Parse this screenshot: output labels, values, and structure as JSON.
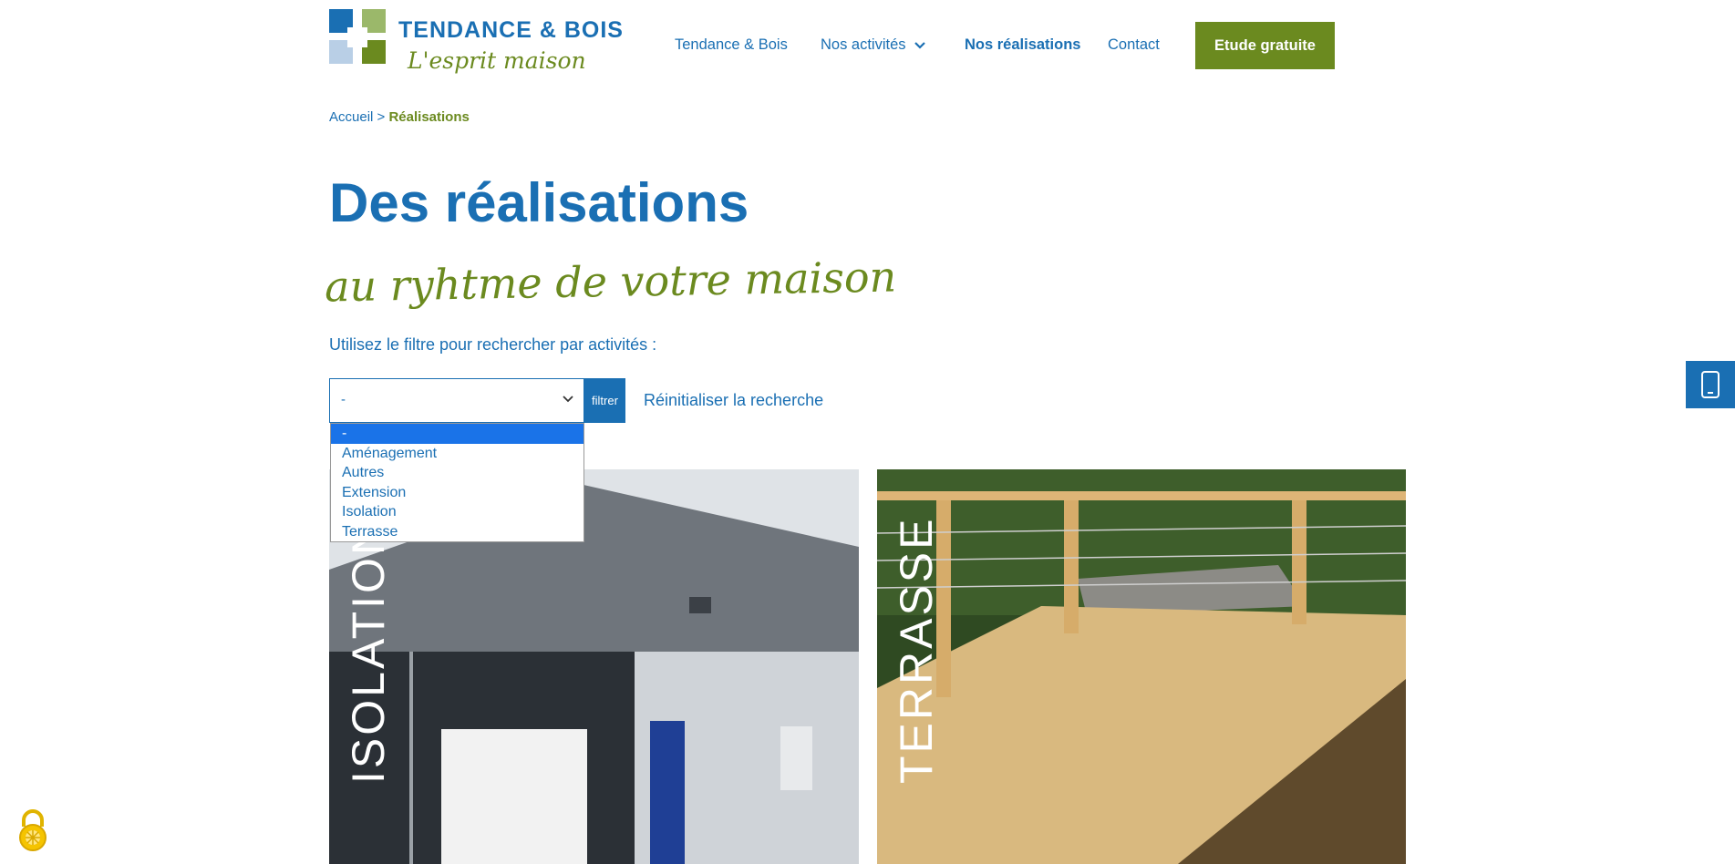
{
  "header": {
    "logo_brand": "TENDANCE & BOIS",
    "logo_tagline": "L'esprit maison",
    "nav": [
      {
        "label": "Tendance & Bois"
      },
      {
        "label": "Nos activités"
      },
      {
        "label": "Nos réalisations"
      },
      {
        "label": "Contact"
      }
    ],
    "cta_label": "Etude gratuite"
  },
  "breadcrumb": {
    "home": "Accueil",
    "separator": ">",
    "current": "Réalisations"
  },
  "main": {
    "title": "Des réalisations",
    "subtitle": "au ryhtme de votre maison",
    "filter_hint": "Utilisez le filtre pour rechercher par activités :",
    "select_value": "-",
    "filter_button": "filtrer",
    "reset_link": "Réinitialiser la recherche",
    "options": [
      "-",
      "Aménagement",
      "Autres",
      "Extension",
      "Isolation",
      "Terrasse"
    ],
    "selected_option": "-"
  },
  "cards": [
    {
      "label": "ISOLATION"
    },
    {
      "label": "TERRASSE"
    }
  ],
  "icons": {
    "side": "phone-icon",
    "cookie": "cookie-lock-icon",
    "nav_chevron": "chevron-down-icon"
  },
  "colors": {
    "brand_blue": "#1a6fb3",
    "brand_green": "#6b8a1f",
    "option_highlight": "#1a73e8"
  }
}
